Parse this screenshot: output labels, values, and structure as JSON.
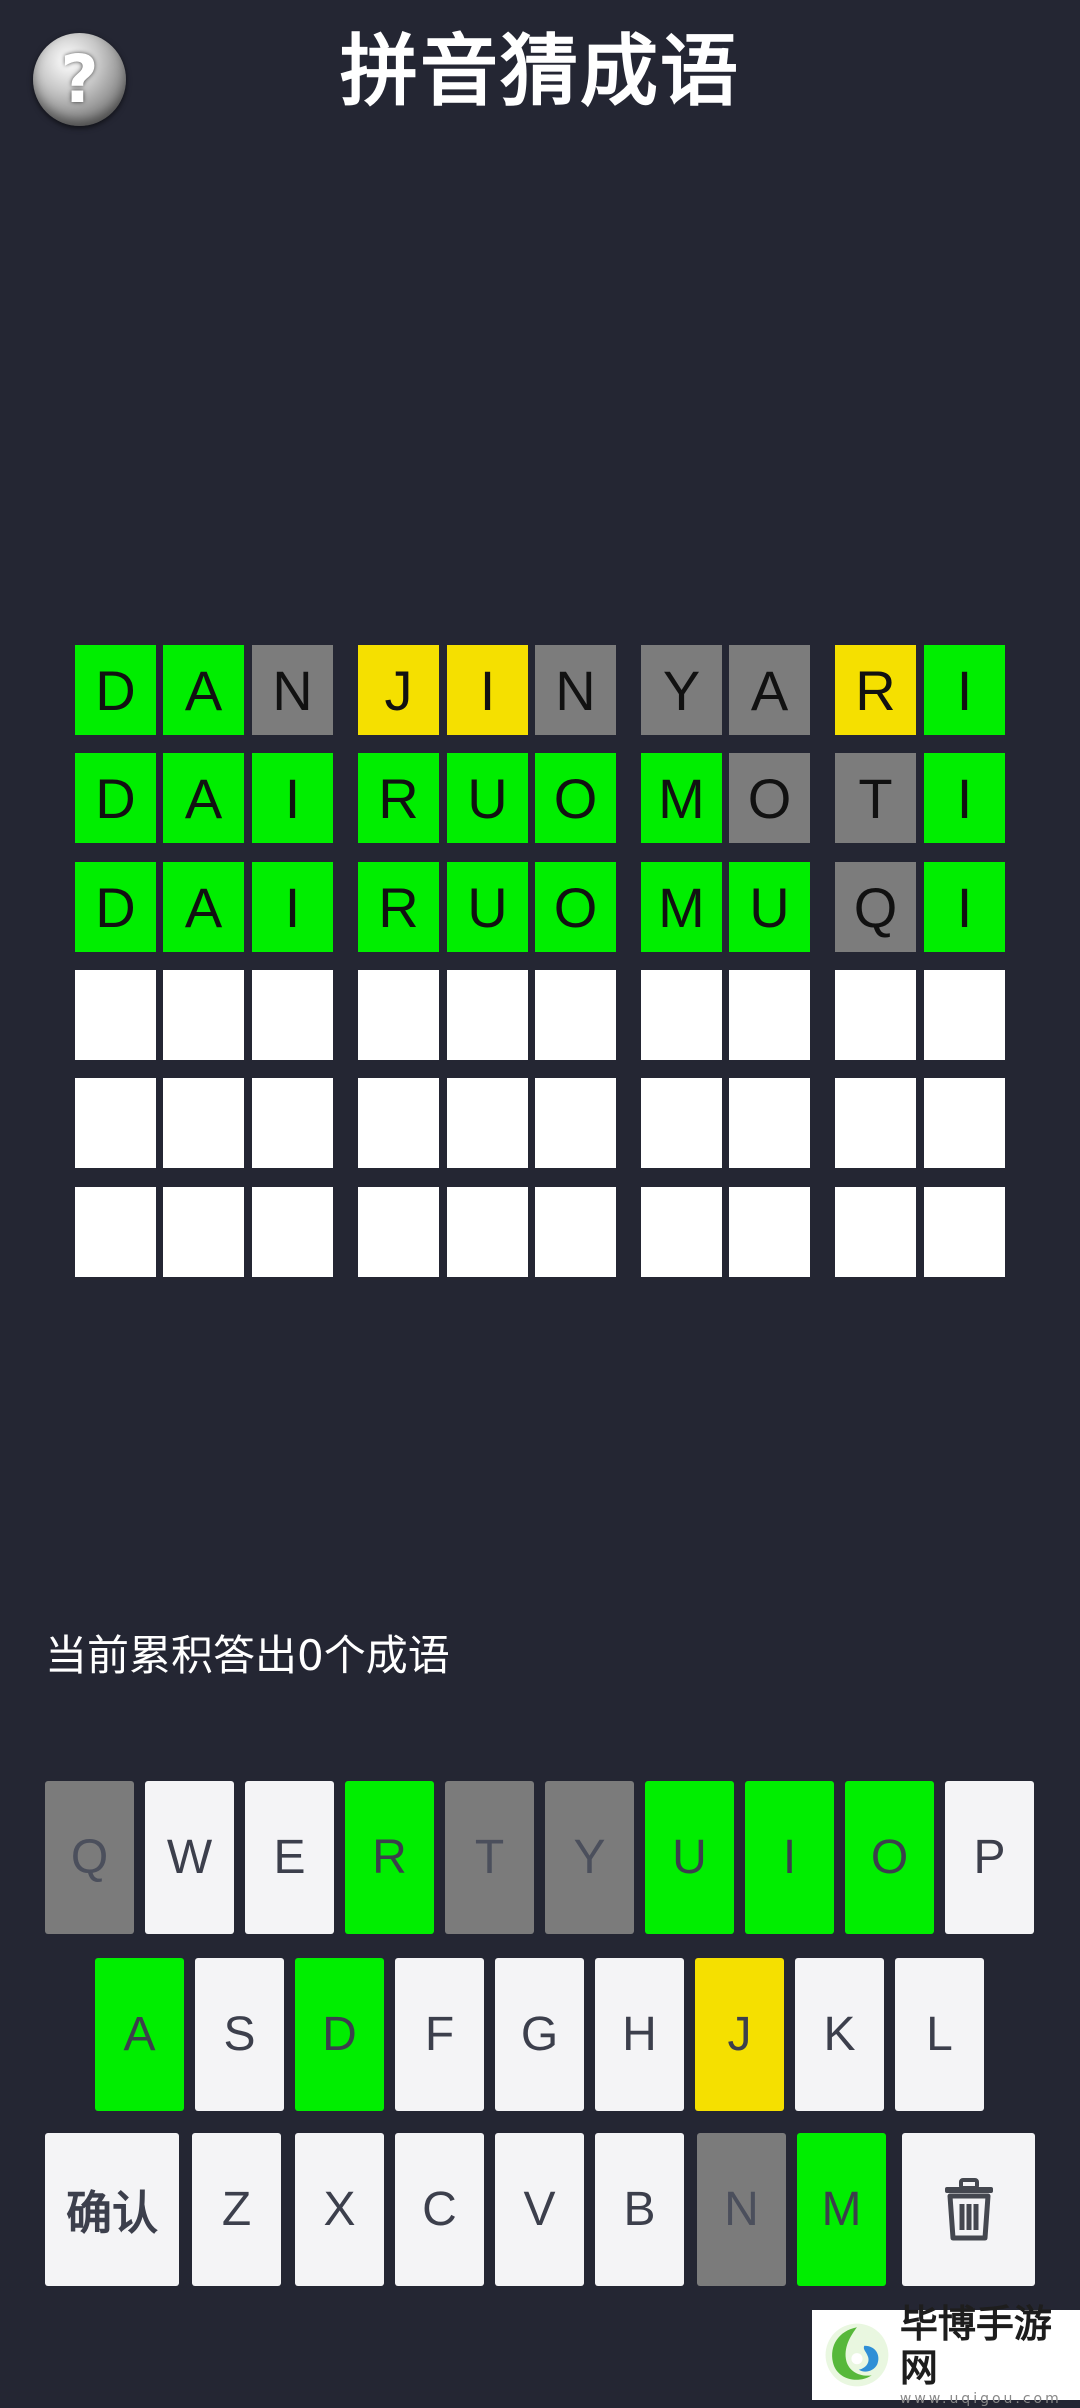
{
  "header": {
    "help_icon_glyph": "?",
    "title": "拼音猜成语"
  },
  "board": {
    "rows": [
      [
        [
          "D",
          "green"
        ],
        [
          "A",
          "green"
        ],
        [
          "N",
          "gray"
        ],
        [
          "J",
          "yellow"
        ],
        [
          "I",
          "yellow"
        ],
        [
          "N",
          "gray"
        ],
        [
          "Y",
          "gray"
        ],
        [
          "A",
          "gray"
        ],
        [
          "R",
          "yellow"
        ],
        [
          "I",
          "green"
        ]
      ],
      [
        [
          "D",
          "green"
        ],
        [
          "A",
          "green"
        ],
        [
          "I",
          "green"
        ],
        [
          "R",
          "green"
        ],
        [
          "U",
          "green"
        ],
        [
          "O",
          "green"
        ],
        [
          "M",
          "green"
        ],
        [
          "O",
          "gray"
        ],
        [
          "T",
          "gray"
        ],
        [
          "I",
          "green"
        ]
      ],
      [
        [
          "D",
          "green"
        ],
        [
          "A",
          "green"
        ],
        [
          "I",
          "green"
        ],
        [
          "R",
          "green"
        ],
        [
          "U",
          "green"
        ],
        [
          "O",
          "green"
        ],
        [
          "M",
          "green"
        ],
        [
          "U",
          "green"
        ],
        [
          "Q",
          "gray"
        ],
        [
          "I",
          "green"
        ]
      ],
      [
        [
          "",
          "empty"
        ],
        [
          "",
          "empty"
        ],
        [
          "",
          "empty"
        ],
        [
          "",
          "empty"
        ],
        [
          "",
          "empty"
        ],
        [
          "",
          "empty"
        ],
        [
          "",
          "empty"
        ],
        [
          "",
          "empty"
        ],
        [
          "",
          "empty"
        ],
        [
          "",
          "empty"
        ]
      ],
      [
        [
          "",
          "empty"
        ],
        [
          "",
          "empty"
        ],
        [
          "",
          "empty"
        ],
        [
          "",
          "empty"
        ],
        [
          "",
          "empty"
        ],
        [
          "",
          "empty"
        ],
        [
          "",
          "empty"
        ],
        [
          "",
          "empty"
        ],
        [
          "",
          "empty"
        ],
        [
          "",
          "empty"
        ]
      ],
      [
        [
          "",
          "empty"
        ],
        [
          "",
          "empty"
        ],
        [
          "",
          "empty"
        ],
        [
          "",
          "empty"
        ],
        [
          "",
          "empty"
        ],
        [
          "",
          "empty"
        ],
        [
          "",
          "empty"
        ],
        [
          "",
          "empty"
        ],
        [
          "",
          "empty"
        ],
        [
          "",
          "empty"
        ]
      ]
    ]
  },
  "score_text": "当前累积答出0个成语",
  "keyboard": {
    "rows": [
      [
        [
          "Q",
          "gray"
        ],
        [
          "W",
          "default"
        ],
        [
          "E",
          "default"
        ],
        [
          "R",
          "green"
        ],
        [
          "T",
          "gray"
        ],
        [
          "Y",
          "gray"
        ],
        [
          "U",
          "green"
        ],
        [
          "I",
          "green"
        ],
        [
          "O",
          "green"
        ],
        [
          "P",
          "default"
        ]
      ],
      [
        [
          "A",
          "green"
        ],
        [
          "S",
          "default"
        ],
        [
          "D",
          "green"
        ],
        [
          "F",
          "default"
        ],
        [
          "G",
          "default"
        ],
        [
          "H",
          "default"
        ],
        [
          "J",
          "yellow"
        ],
        [
          "K",
          "default"
        ],
        [
          "L",
          "default"
        ]
      ],
      [
        [
          "确认",
          "default"
        ],
        [
          "Z",
          "default"
        ],
        [
          "X",
          "default"
        ],
        [
          "C",
          "default"
        ],
        [
          "V",
          "default"
        ],
        [
          "B",
          "default"
        ],
        [
          "N",
          "gray"
        ],
        [
          "M",
          "green"
        ],
        [
          "delete",
          "default"
        ]
      ]
    ],
    "confirm_label": "确认",
    "delete_icon": "trash-icon"
  },
  "watermark": {
    "title": "毕博手游网",
    "url": "www.uqigou.com"
  },
  "colors": {
    "background": "#242633",
    "green": "#00ee00",
    "yellow": "#f5e000",
    "gray": "#7c7c7c",
    "key_default": "#f4f4f6"
  }
}
